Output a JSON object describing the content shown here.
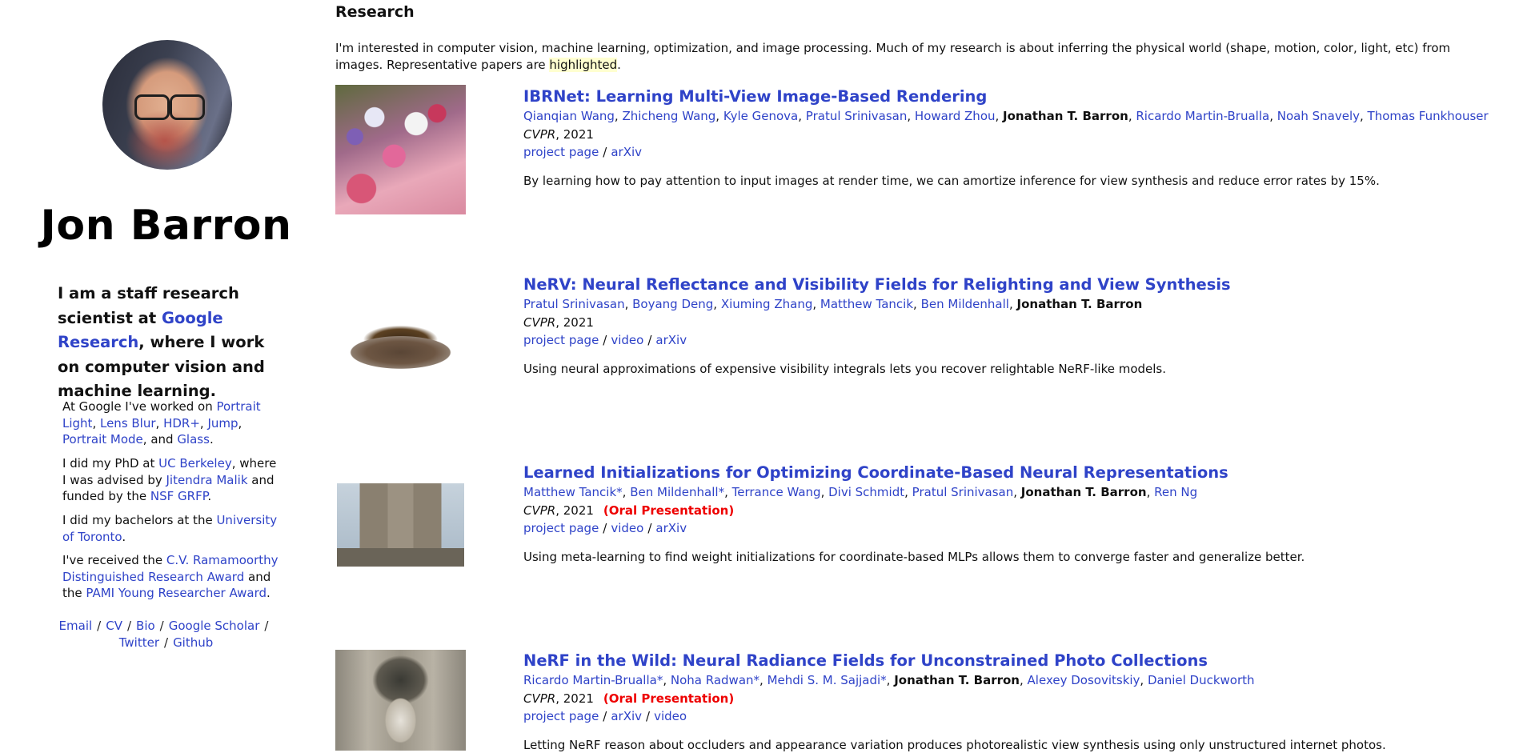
{
  "profile": {
    "name": "Jon Barron",
    "lead_pre": "I am a staff research scientist at ",
    "lead_link": "Google Research",
    "lead_post": ", where I work on computer vision and machine learning.",
    "google_pre": "At Google I've worked on ",
    "google_projects": [
      "Portrait Light",
      "Lens Blur",
      "HDR+",
      "Jump",
      "Portrait Mode",
      "Glass"
    ],
    "phd_pre": "I did my PhD at ",
    "phd_school": "UC Berkeley",
    "phd_mid": ", where I was advised by ",
    "phd_advisor": "Jitendra Malik",
    "phd_mid2": " and funded by the ",
    "phd_funding": "NSF GRFP",
    "bach_pre": "I did my bachelors at the ",
    "bach_school": "University of Toronto",
    "award_pre": "I've received the ",
    "award1": "C.V. Ramamoorthy Distinguished Research Award",
    "award_mid": " and the ",
    "award2": "PAMI Young Researcher Award",
    "links": [
      "Email",
      "CV",
      "Bio",
      "Google Scholar",
      "Twitter",
      "Github"
    ]
  },
  "research": {
    "heading": "Research",
    "intro_pre": "I'm interested in computer vision, machine learning, optimization, and image processing. Much of my research is about inferring the physical world (shape, motion, color, light, etc) from images. Representative papers are ",
    "intro_highlight": "highlighted",
    "intro_post": "."
  },
  "publications": [
    {
      "title": "IBRNet: Learning Multi-View Image-Based Rendering",
      "authors_before": [
        "Qianqian Wang",
        "Zhicheng Wang",
        "Kyle Genova",
        "Pratul Srinivasan",
        "Howard Zhou"
      ],
      "me": "Jonathan T. Barron",
      "authors_after": [
        "Ricardo Martin-Brualla",
        "Noah Snavely",
        "Thomas Funkhouser"
      ],
      "venue": "CVPR",
      "year": ", 2021",
      "oral": "",
      "links": [
        "project page",
        "arXiv"
      ],
      "description": "By learning how to pay attention to input images at render time, we can amortize inference for view synthesis and reduce error rates by 15%."
    },
    {
      "title": "NeRV: Neural Reflectance and Visibility Fields for Relighting and View Synthesis",
      "authors_before": [
        "Pratul Srinivasan",
        "Boyang Deng",
        "Xiuming Zhang",
        "Matthew Tancik",
        "Ben Mildenhall"
      ],
      "me": "Jonathan T. Barron",
      "authors_after": [],
      "venue": "CVPR",
      "year": ", 2021",
      "oral": "",
      "links": [
        "project page",
        "video",
        "arXiv"
      ],
      "description": "Using neural approximations of expensive visibility integrals lets you recover relightable NeRF-like models."
    },
    {
      "title": "Learned Initializations for Optimizing Coordinate-Based Neural Representations",
      "authors_before": [
        "Matthew Tancik*",
        "Ben Mildenhall*",
        "Terrance Wang",
        "Divi Schmidt",
        "Pratul Srinivasan"
      ],
      "me": "Jonathan T. Barron",
      "authors_after": [
        "Ren Ng"
      ],
      "venue": "CVPR",
      "year": ", 2021",
      "oral": "(Oral Presentation)",
      "links": [
        "project page",
        "video",
        "arXiv"
      ],
      "description": "Using meta-learning to find weight initializations for coordinate-based MLPs allows them to converge faster and generalize better."
    },
    {
      "title": "NeRF in the Wild: Neural Radiance Fields for Unconstrained Photo Collections",
      "authors_before": [
        "Ricardo Martin-Brualla*",
        "Noha Radwan*",
        "Mehdi S. M. Sajjadi*"
      ],
      "me": "Jonathan T. Barron",
      "authors_after": [
        "Alexey Dosovitskiy",
        "Daniel Duckworth"
      ],
      "venue": "CVPR",
      "year": ", 2021",
      "oral": "(Oral Presentation)",
      "links": [
        "project page",
        "arXiv",
        "video"
      ],
      "description": "Letting NeRF reason about occluders and appearance variation produces photorealistic view synthesis using only unstructured internet photos."
    }
  ]
}
